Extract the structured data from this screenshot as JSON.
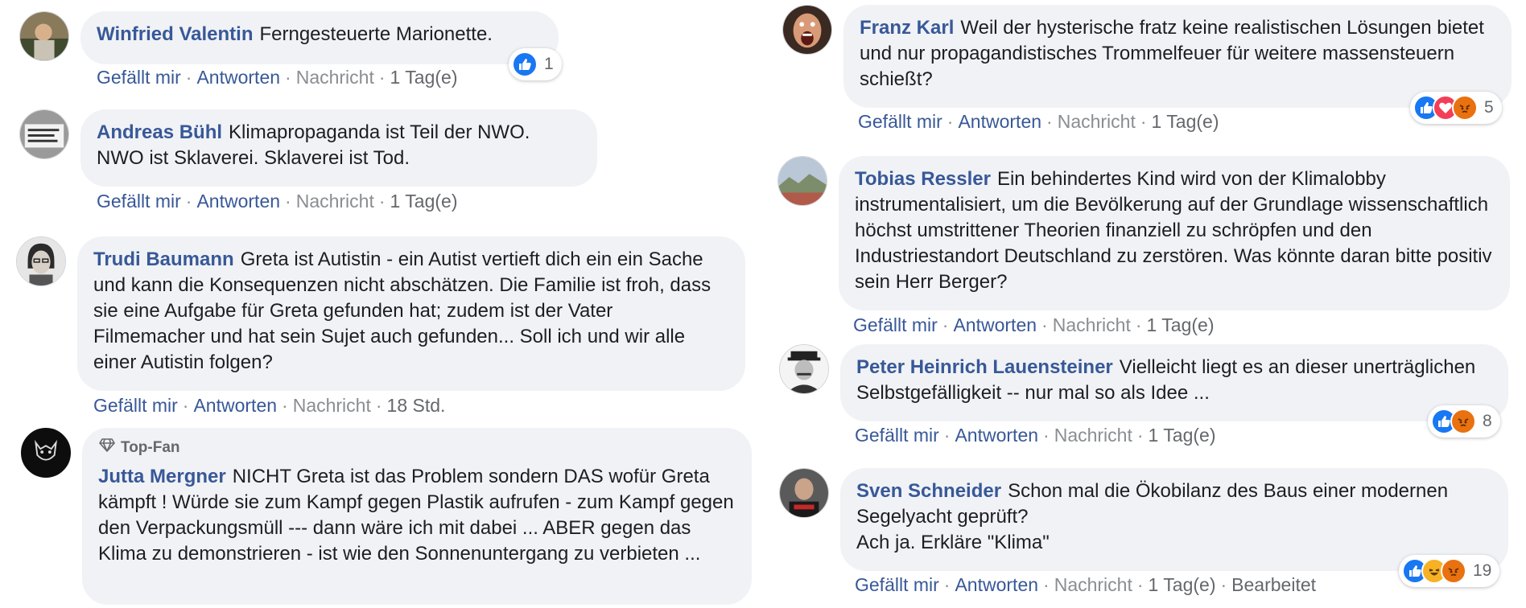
{
  "comments": [
    {
      "author": "Winfried Valentin",
      "text": "Ferngesteuerte Marionette.",
      "like": "Gefällt mir",
      "reply": "Antworten",
      "message": "Nachricht",
      "time": "1 Tag(e)",
      "reaction_count": "1"
    },
    {
      "author": "Andreas Bühl",
      "text": "Klimapropaganda ist Teil der NWO. NWO ist Sklaverei. Sklaverei ist Tod.",
      "like": "Gefällt mir",
      "reply": "Antworten",
      "message": "Nachricht",
      "time": "1 Tag(e)"
    },
    {
      "author": "Trudi Baumann",
      "text": "Greta ist Autistin - ein Autist vertieft dich ein ein Sache und kann die Konsequenzen nicht abschätzen. Die Familie ist froh, dass sie eine Aufgabe für Greta gefunden hat; zudem ist der Vater Filmemacher und hat sein Sujet auch gefunden... Soll ich und wir alle einer Autistin folgen?",
      "like": "Gefällt mir",
      "reply": "Antworten",
      "message": "Nachricht",
      "time": "18 Std."
    },
    {
      "badge": "Top-Fan",
      "author": "Jutta Mergner",
      "text": "NICHT Greta ist das Problem sondern DAS wofür Greta kämpft ! Würde sie zum Kampf gegen Plastik aufrufen - zum Kampf gegen den Verpackungsmüll --- dann wäre ich mit dabei ... ABER gegen das Klima zu demonstrieren - ist wie den Sonnenuntergang zu verbieten ..."
    },
    {
      "author": "Franz Karl",
      "text": "Weil der hysterische fratz keine realistischen Lösungen bietet und nur propagandistisches Trommelfeuer für weitere massensteuern schießt?",
      "like": "Gefällt mir",
      "reply": "Antworten",
      "message": "Nachricht",
      "time": "1 Tag(e)",
      "reaction_count": "5"
    },
    {
      "author": "Tobias Ressler",
      "text": "Ein behindertes Kind wird von der Klimalobby instrumentalisiert, um die Bevölkerung auf der Grundlage wissenschaftlich höchst umstrittener Theorien finanziell zu schröpfen und den Industriestandort Deutschland zu zerstören. Was könnte daran bitte positiv sein Herr Berger?",
      "like": "Gefällt mir",
      "reply": "Antworten",
      "message": "Nachricht",
      "time": "1 Tag(e)"
    },
    {
      "author": "Peter Heinrich Lauensteiner",
      "text": "Vielleicht liegt es an dieser unerträglichen Selbstgefälligkeit -- nur mal so als Idee ...",
      "like": "Gefällt mir",
      "reply": "Antworten",
      "message": "Nachricht",
      "time": "1 Tag(e)",
      "reaction_count": "8"
    },
    {
      "author": "Sven Schneider",
      "text_line1": "Schon mal die Ökobilanz des Baus einer modernen Segelyacht geprüft?",
      "text_line2": "Ach ja. Erkläre \"Klima\"",
      "like": "Gefällt mir",
      "reply": "Antworten",
      "message": "Nachricht",
      "time": "1 Tag(e)",
      "edited": "Bearbeitet",
      "reaction_count": "19"
    }
  ],
  "colors": {
    "author_link": "#385898",
    "bubble_bg": "#f0f2f5",
    "like_blue": "#1877f2",
    "love_red": "#f33e58",
    "angry_orange": "#e9710f"
  },
  "icons": {
    "like": "thumbs-up-icon",
    "love": "heart-icon",
    "angry": "angry-face-icon",
    "haha": "laughing-face-icon",
    "top_fan": "diamond-icon"
  }
}
